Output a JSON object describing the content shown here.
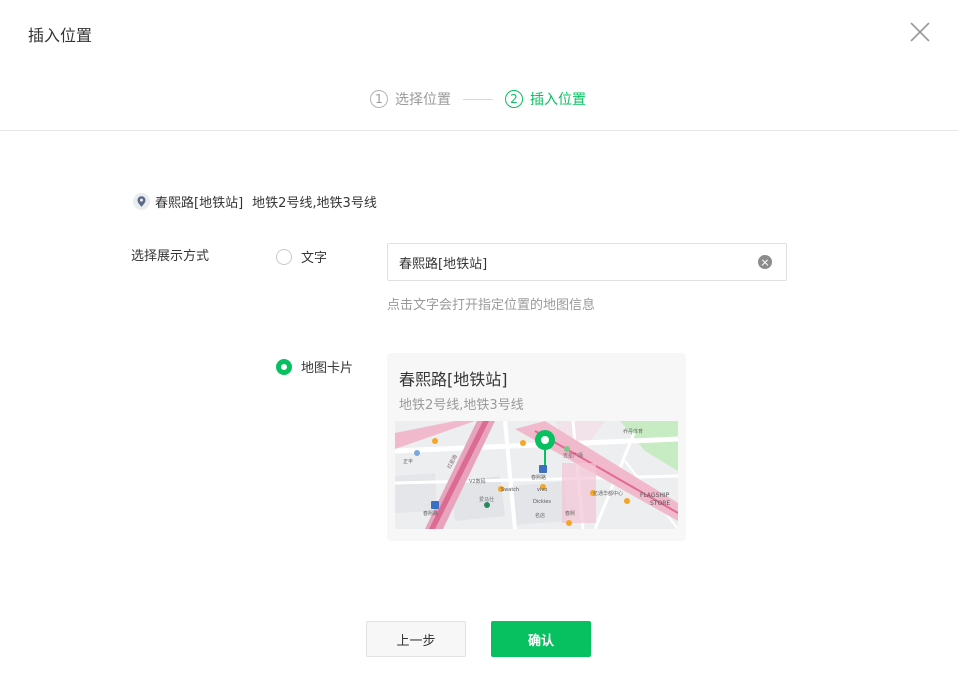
{
  "dialog": {
    "title": "插入位置"
  },
  "steps": [
    {
      "num": "1",
      "label": "选择位置"
    },
    {
      "num": "2",
      "label": "插入位置"
    }
  ],
  "location": {
    "name": "春熙路[地铁站]",
    "lines": "地铁2号线,地铁3号线"
  },
  "display_mode": {
    "label": "选择展示方式",
    "options": [
      {
        "label": "文字",
        "checked": false
      },
      {
        "label": "地图卡片",
        "checked": true
      }
    ]
  },
  "text_option": {
    "value": "春熙路[地铁站]",
    "hint": "点击文字会打开指定位置的地图信息"
  },
  "map_card": {
    "title": "春熙路[地铁站]",
    "subtitle": "地铁2号线,地铁3号线",
    "map_labels": {
      "metro_top": "春熙路",
      "metro_left": "春熙路",
      "plaza": "吉星广场",
      "flagship_1": "FLAGSHIP",
      "flagship_2": "STORE",
      "swatch": "Swatch",
      "vivo": "vivo",
      "dickies": "Dickies",
      "v2": "V2数码",
      "hermes": "爱马仕",
      "zhengfeng": "正丰",
      "shop1": "名店",
      "shop2": "春熙",
      "mall": "亿通华都中心",
      "sport": "乔丹体育",
      "road": "红星路"
    }
  },
  "buttons": {
    "prev": "上一步",
    "confirm": "确认"
  },
  "colors": {
    "primary": "#07c160",
    "text": "#353535",
    "muted": "#9a9a9a"
  },
  "icons": {
    "close": "close-icon",
    "pin": "location-pin-icon",
    "clear": "clear-icon",
    "map_marker": "map-marker-icon"
  }
}
